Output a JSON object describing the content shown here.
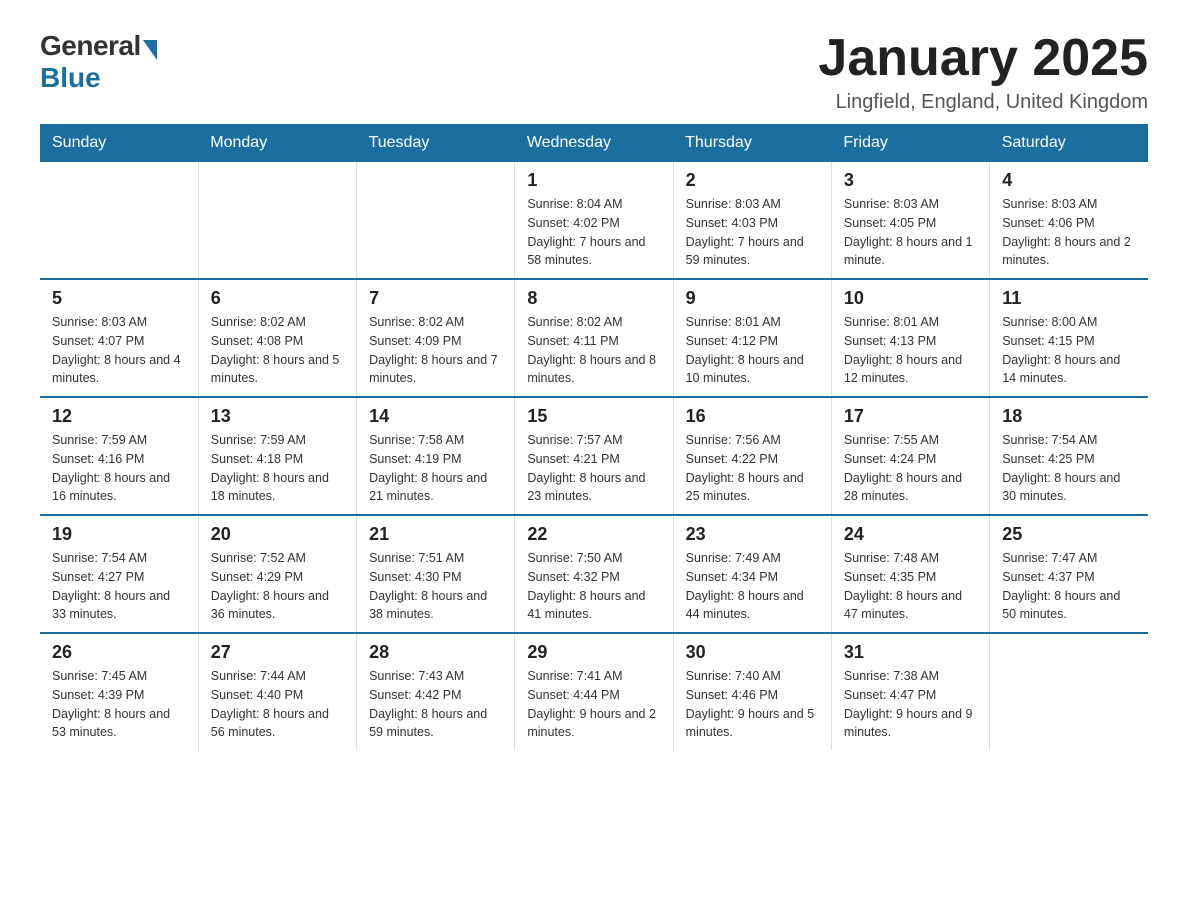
{
  "logo": {
    "general": "General",
    "blue": "Blue"
  },
  "title": "January 2025",
  "location": "Lingfield, England, United Kingdom",
  "days_header": [
    "Sunday",
    "Monday",
    "Tuesday",
    "Wednesday",
    "Thursday",
    "Friday",
    "Saturday"
  ],
  "weeks": [
    [
      {
        "day": "",
        "info": ""
      },
      {
        "day": "",
        "info": ""
      },
      {
        "day": "",
        "info": ""
      },
      {
        "day": "1",
        "info": "Sunrise: 8:04 AM\nSunset: 4:02 PM\nDaylight: 7 hours\nand 58 minutes."
      },
      {
        "day": "2",
        "info": "Sunrise: 8:03 AM\nSunset: 4:03 PM\nDaylight: 7 hours\nand 59 minutes."
      },
      {
        "day": "3",
        "info": "Sunrise: 8:03 AM\nSunset: 4:05 PM\nDaylight: 8 hours\nand 1 minute."
      },
      {
        "day": "4",
        "info": "Sunrise: 8:03 AM\nSunset: 4:06 PM\nDaylight: 8 hours\nand 2 minutes."
      }
    ],
    [
      {
        "day": "5",
        "info": "Sunrise: 8:03 AM\nSunset: 4:07 PM\nDaylight: 8 hours\nand 4 minutes."
      },
      {
        "day": "6",
        "info": "Sunrise: 8:02 AM\nSunset: 4:08 PM\nDaylight: 8 hours\nand 5 minutes."
      },
      {
        "day": "7",
        "info": "Sunrise: 8:02 AM\nSunset: 4:09 PM\nDaylight: 8 hours\nand 7 minutes."
      },
      {
        "day": "8",
        "info": "Sunrise: 8:02 AM\nSunset: 4:11 PM\nDaylight: 8 hours\nand 8 minutes."
      },
      {
        "day": "9",
        "info": "Sunrise: 8:01 AM\nSunset: 4:12 PM\nDaylight: 8 hours\nand 10 minutes."
      },
      {
        "day": "10",
        "info": "Sunrise: 8:01 AM\nSunset: 4:13 PM\nDaylight: 8 hours\nand 12 minutes."
      },
      {
        "day": "11",
        "info": "Sunrise: 8:00 AM\nSunset: 4:15 PM\nDaylight: 8 hours\nand 14 minutes."
      }
    ],
    [
      {
        "day": "12",
        "info": "Sunrise: 7:59 AM\nSunset: 4:16 PM\nDaylight: 8 hours\nand 16 minutes."
      },
      {
        "day": "13",
        "info": "Sunrise: 7:59 AM\nSunset: 4:18 PM\nDaylight: 8 hours\nand 18 minutes."
      },
      {
        "day": "14",
        "info": "Sunrise: 7:58 AM\nSunset: 4:19 PM\nDaylight: 8 hours\nand 21 minutes."
      },
      {
        "day": "15",
        "info": "Sunrise: 7:57 AM\nSunset: 4:21 PM\nDaylight: 8 hours\nand 23 minutes."
      },
      {
        "day": "16",
        "info": "Sunrise: 7:56 AM\nSunset: 4:22 PM\nDaylight: 8 hours\nand 25 minutes."
      },
      {
        "day": "17",
        "info": "Sunrise: 7:55 AM\nSunset: 4:24 PM\nDaylight: 8 hours\nand 28 minutes."
      },
      {
        "day": "18",
        "info": "Sunrise: 7:54 AM\nSunset: 4:25 PM\nDaylight: 8 hours\nand 30 minutes."
      }
    ],
    [
      {
        "day": "19",
        "info": "Sunrise: 7:54 AM\nSunset: 4:27 PM\nDaylight: 8 hours\nand 33 minutes."
      },
      {
        "day": "20",
        "info": "Sunrise: 7:52 AM\nSunset: 4:29 PM\nDaylight: 8 hours\nand 36 minutes."
      },
      {
        "day": "21",
        "info": "Sunrise: 7:51 AM\nSunset: 4:30 PM\nDaylight: 8 hours\nand 38 minutes."
      },
      {
        "day": "22",
        "info": "Sunrise: 7:50 AM\nSunset: 4:32 PM\nDaylight: 8 hours\nand 41 minutes."
      },
      {
        "day": "23",
        "info": "Sunrise: 7:49 AM\nSunset: 4:34 PM\nDaylight: 8 hours\nand 44 minutes."
      },
      {
        "day": "24",
        "info": "Sunrise: 7:48 AM\nSunset: 4:35 PM\nDaylight: 8 hours\nand 47 minutes."
      },
      {
        "day": "25",
        "info": "Sunrise: 7:47 AM\nSunset: 4:37 PM\nDaylight: 8 hours\nand 50 minutes."
      }
    ],
    [
      {
        "day": "26",
        "info": "Sunrise: 7:45 AM\nSunset: 4:39 PM\nDaylight: 8 hours\nand 53 minutes."
      },
      {
        "day": "27",
        "info": "Sunrise: 7:44 AM\nSunset: 4:40 PM\nDaylight: 8 hours\nand 56 minutes."
      },
      {
        "day": "28",
        "info": "Sunrise: 7:43 AM\nSunset: 4:42 PM\nDaylight: 8 hours\nand 59 minutes."
      },
      {
        "day": "29",
        "info": "Sunrise: 7:41 AM\nSunset: 4:44 PM\nDaylight: 9 hours\nand 2 minutes."
      },
      {
        "day": "30",
        "info": "Sunrise: 7:40 AM\nSunset: 4:46 PM\nDaylight: 9 hours\nand 5 minutes."
      },
      {
        "day": "31",
        "info": "Sunrise: 7:38 AM\nSunset: 4:47 PM\nDaylight: 9 hours\nand 9 minutes."
      },
      {
        "day": "",
        "info": ""
      }
    ]
  ]
}
